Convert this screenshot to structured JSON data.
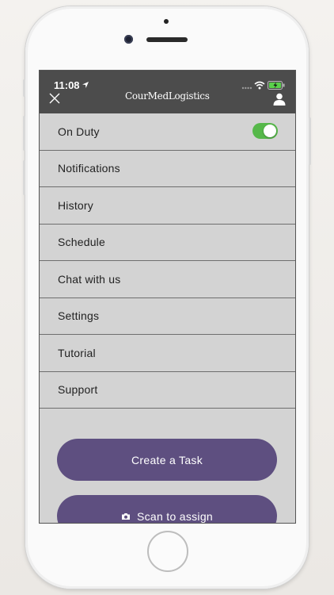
{
  "status_bar": {
    "time": "11:08"
  },
  "header": {
    "logo_text": "CourMedLogistics",
    "close_icon": "close-icon",
    "user_icon": "user-icon"
  },
  "menu": {
    "items": [
      {
        "label": "On Duty",
        "toggle": true,
        "toggle_on": true
      },
      {
        "label": "Notifications"
      },
      {
        "label": "History"
      },
      {
        "label": "Schedule"
      },
      {
        "label": "Chat with us"
      },
      {
        "label": "Settings"
      },
      {
        "label": "Tutorial"
      },
      {
        "label": "Support"
      }
    ]
  },
  "actions": {
    "create_task_label": "Create a Task",
    "scan_label": "Scan to assign",
    "scan_icon": "camera-icon"
  },
  "colors": {
    "header_bg": "#4c4c4c",
    "menu_bg": "#d3d3d3",
    "accent_button": "#5e4f80",
    "toggle_on": "#56b84a"
  }
}
